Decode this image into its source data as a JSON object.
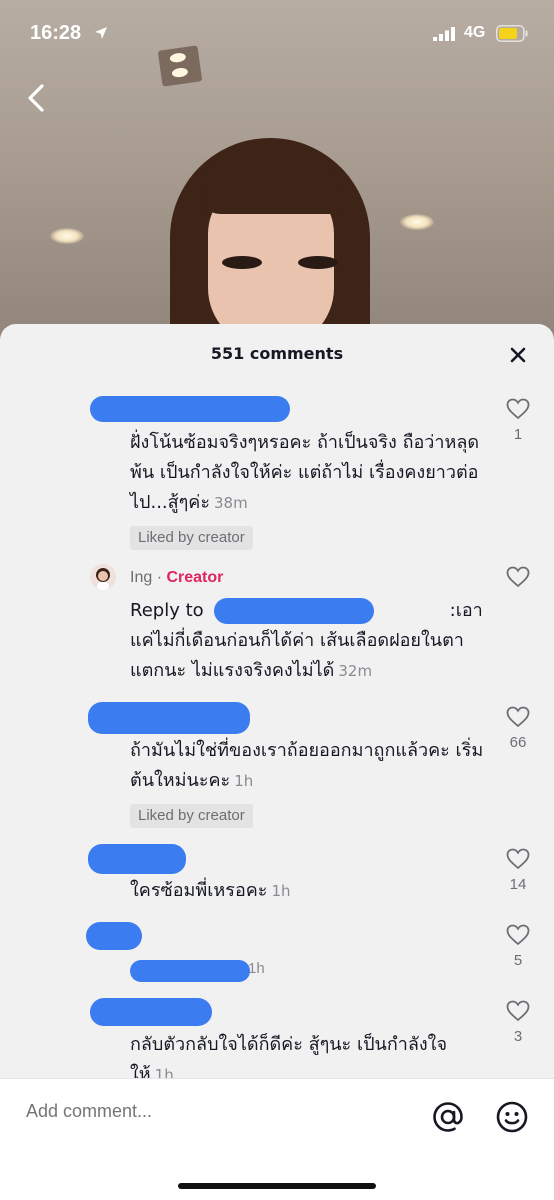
{
  "status_bar": {
    "time": "16:28",
    "network": "4G",
    "icons": [
      "location-arrow-icon",
      "signal-icon",
      "battery-icon"
    ]
  },
  "comments_sheet": {
    "title": "551 comments",
    "close_icon": "close-icon",
    "comments": [
      {
        "author": "",
        "text": "ฝั่งโน้นซ้อมจริงๆหรอคะ ถ้าเป็นจริง ถือว่าหลุดพ้น เป็นกำลังใจให้ค่ะ แต่ถ้าไม่ เรื่องคงยาวต่อไป...สู้ๆค่ะ",
        "time": "38m",
        "liked_by_creator": "Liked by creator",
        "likes": "1"
      },
      {
        "author": "Ing",
        "separator": " · ",
        "author_tag": "Creator",
        "reply_prefix": "Reply to",
        "text": ":เอาแค่ไม่กี่เดือนก่อนก็ได้ค่า เส้นเลือดฝอยในตาแตกนะ ไม่แรงจริงคงไม่ได้",
        "time": "32m",
        "likes": ""
      },
      {
        "author": "",
        "text": "ถ้ามันไม่ใช่ที่ของเราถ้อยออกมาถูกแล้วคะ เริ่มต้นใหม่นะคะ",
        "time": "1h",
        "liked_by_creator": "Liked by creator",
        "likes": "66"
      },
      {
        "author": "",
        "text": "ใครซ้อมพี่เหรอคะ",
        "time": "1h",
        "likes": "14"
      },
      {
        "author": "",
        "text": "",
        "time": "1h",
        "likes": "5"
      },
      {
        "author": "",
        "text": "กลับตัวกลับใจได้ก็ดีค่ะ สู้ๆนะ เป็นกำลังใจให้",
        "time": "1h",
        "likes": "3"
      }
    ]
  },
  "comment_bar": {
    "placeholder": "Add comment...",
    "icons": [
      "at-mention-icon",
      "emoji-icon"
    ]
  },
  "colors": {
    "creator_tag": "#e0245e",
    "redaction": "#3b7cf0",
    "sheet_background": "#f1f1f2"
  }
}
